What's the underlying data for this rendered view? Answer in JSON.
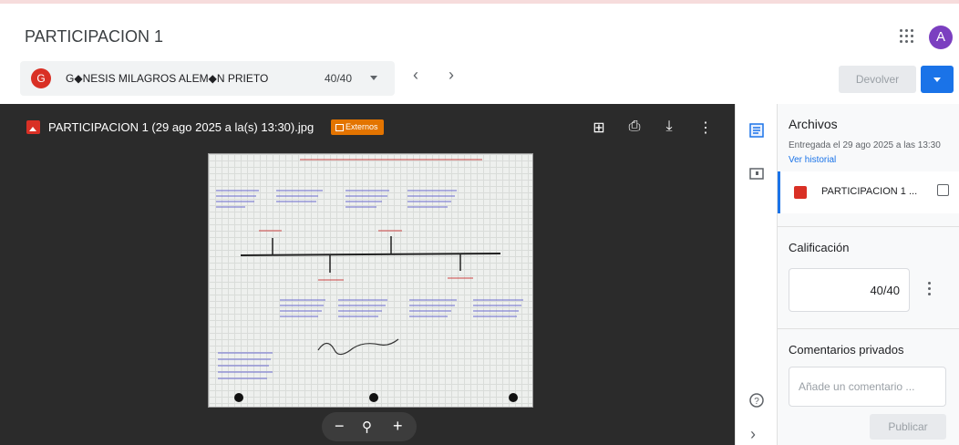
{
  "assignment_title": "PARTICIPACION 1",
  "user_avatar_letter": "A",
  "student": {
    "avatar_letter": "G",
    "name": "G◆NESIS MILAGROS ALEM◆N PRIETO",
    "grade": "40/40"
  },
  "actions": {
    "return_label": "Devolver"
  },
  "viewer": {
    "file_name": "PARTICIPACION 1 (29 ago 2025 a la(s) 13:30).jpg",
    "badge": "Externos"
  },
  "panel": {
    "files_title": "Archivos",
    "submitted": "Entregada el 29 ago 2025 a las 13:30",
    "history_link": "Ver historial",
    "attachment_name": "PARTICIPACION 1 ...",
    "grade_title": "Calificación",
    "grade_value": "40/40",
    "comments_title": "Comentarios privados",
    "comment_placeholder": "Añade un comentario ...",
    "publish_label": "Publicar"
  },
  "colors": {
    "accent": "#1a73e8",
    "viewer_bg": "#2b2b2b",
    "badge": "#e37400",
    "student_avatar": "#d93025",
    "user_avatar": "#7b3fc0"
  }
}
